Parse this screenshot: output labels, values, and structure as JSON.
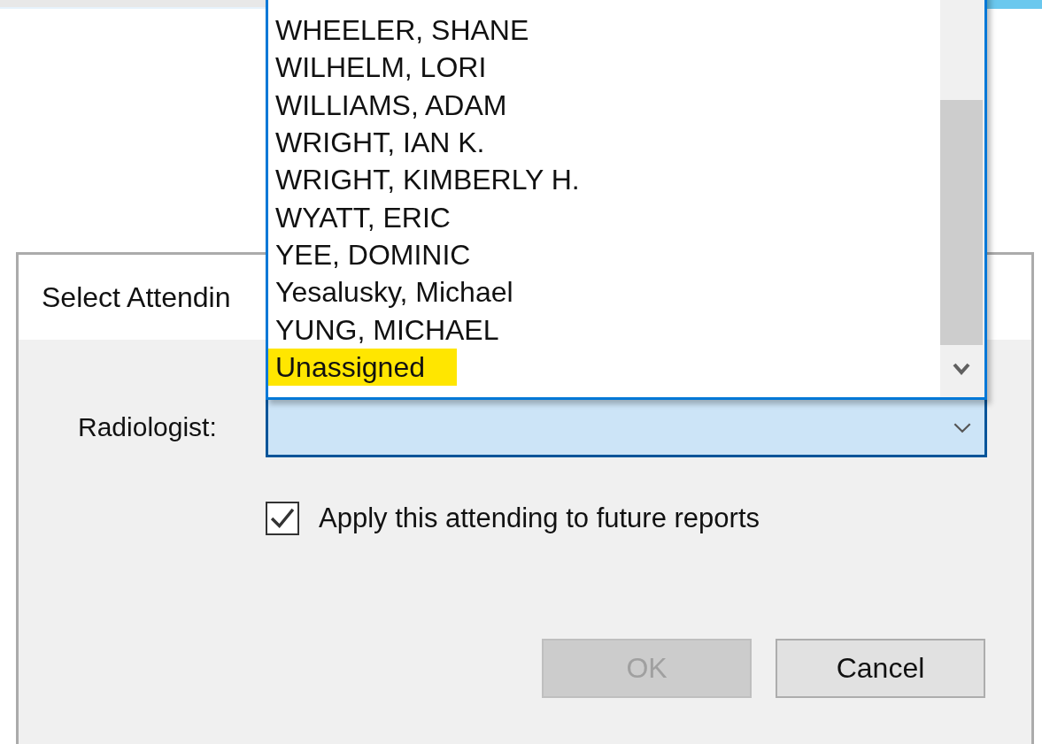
{
  "dialog": {
    "title": "Select Attendin",
    "radiologist": {
      "label": "Radiologist:"
    },
    "apply_checkbox": {
      "label": "Apply this attending to future reports",
      "checked": true
    },
    "buttons": [
      {
        "label": "OK",
        "disabled": true
      },
      {
        "label": "Cancel",
        "disabled": false
      }
    ]
  },
  "dropdown": {
    "items": [
      {
        "label": "WHEELER, SHANE",
        "highlighted": false
      },
      {
        "label": "WILHELM, LORI",
        "highlighted": false
      },
      {
        "label": "WILLIAMS, ADAM",
        "highlighted": false
      },
      {
        "label": "WRIGHT, IAN K.",
        "highlighted": false
      },
      {
        "label": "WRIGHT, KIMBERLY H.",
        "highlighted": false
      },
      {
        "label": "WYATT, ERIC",
        "highlighted": false
      },
      {
        "label": "YEE, DOMINIC",
        "highlighted": false
      },
      {
        "label": "Yesalusky, Michael",
        "highlighted": false
      },
      {
        "label": "YUNG, MICHAEL",
        "highlighted": false
      },
      {
        "label": "Unassigned",
        "highlighted": true
      }
    ]
  }
}
